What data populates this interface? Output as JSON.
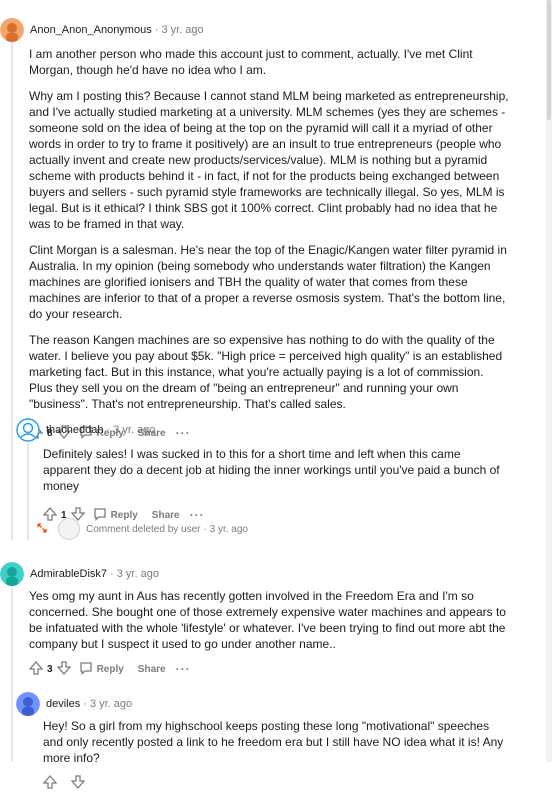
{
  "comments": [
    {
      "author": "Anon_Anon_Anonymous",
      "time": "· 3 yr. ago",
      "paragraphs": [
        "I am another person who made this account just to comment, actually. I've met Clint Morgan, though he'd have no idea who I am.",
        "Why am I posting this? Because I cannot stand MLM being marketed as entrepreneurship, and I've actually studied marketing at a university. MLM schemes (yes they are schemes - someone sold on the idea of being at the top on the pyramid will call it a myriad of other words in order to try to frame it positively) are an insult to true entrepreneurs (people who actually invent and create new products/services/value). MLM is nothing but a pyramid scheme with products behind it - in fact, if not for the products being exchanged between buyers and sellers - such pyramid style frameworks are technically illegal. So yes, MLM is legal. But is it ethical? I think SBS got it 100% correct. Clint probably had no idea that he was to be framed in that way.",
        "Clint Morgan is a salesman. He's near the top of the Enagic/Kangen water filter pyramid in Australia. In my opinion (being somebody who understands water filtration) the Kangen machines are glorified ionisers and TBH the quality of water that comes from these machines are inferior to that of a proper a reverse osmosis system. That's the bottom line, do your research.",
        "The reason Kangen machines are so expensive has nothing to do with the quality of the water. I believe you pay about $5k. \"High price = perceived high quality\" is an established marketing fact. But in this instance, what you're actually paying is a lot of commission. Plus they sell you on the dream of \"being an entrepreneur\" and running your own \"business\". That's not entrepreneurship. That's called sales."
      ],
      "votes": "8",
      "reply": "Reply",
      "share": "Share",
      "more": "···"
    },
    {
      "author": "thacheddah",
      "time": "· 3 yr. ago",
      "paragraphs": [
        "Definitely sales! I was sucked in to this for a short time and left when this came apparent they do a decent job at hiding the inner workings until you've paid a bunch of money"
      ],
      "votes": "1",
      "reply": "Reply",
      "share": "Share",
      "more": "···"
    },
    {
      "author": "AdmirableDisk7",
      "time": "· 3 yr. ago",
      "paragraphs": [
        "Yes omg my aunt in Aus has recently gotten involved in the Freedom Era and I'm so concerned. She bought one of those extremely expensive water machines and appears to be infatuated with the whole 'lifestyle' or whatever. I've been trying to find out more abt the company but I suspect it used to go under another name.."
      ],
      "votes": "3",
      "reply": "Reply",
      "share": "Share",
      "more": "···"
    },
    {
      "author": "deviles",
      "time": "· 3 yr. ago",
      "paragraphs": [
        "Hey! So a girl from my highschool keeps posting these long \"motivational\" speeches and only recently posted a link to he freedom era but I still have NO idea what it is! Any more info?"
      ]
    }
  ],
  "deleted": {
    "text": "Comment deleted by user",
    "time": "· 3 yr. ago"
  },
  "colors": {
    "accent": "#ff4500",
    "meta": "#7c7c7c",
    "line": "#e6e6e6"
  },
  "icons": [
    "upvote-icon",
    "downvote-icon",
    "comment-bubble-icon",
    "expand-arrows-icon",
    "more-icon"
  ]
}
